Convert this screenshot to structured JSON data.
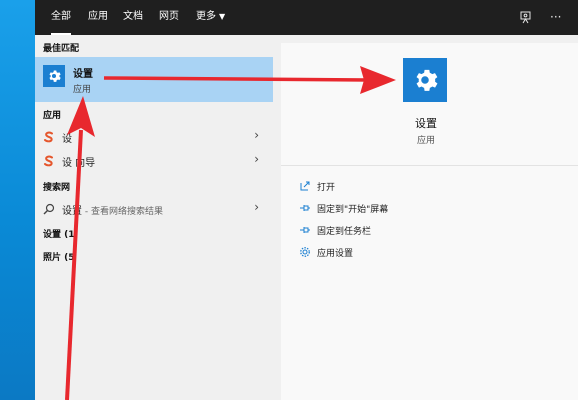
{
  "tabs": [
    "全部",
    "应用",
    "文档",
    "网页",
    "更多"
  ],
  "best_match": {
    "header": "最佳匹配",
    "title": "设置",
    "subtitle": "应用"
  },
  "apps": {
    "header": "应用",
    "items": [
      {
        "label": "设"
      },
      {
        "label": "设 向导"
      }
    ]
  },
  "web": {
    "header": "搜索网",
    "query": "设置",
    "suffix": " - 查看网络搜索结果"
  },
  "settings_header": "设置 (1",
  "photos_header": "照片 (5",
  "detail": {
    "title": "设置",
    "subtitle": "应用",
    "actions": [
      {
        "label": "打开",
        "icon": "open-icon"
      },
      {
        "label": "固定到\"开始\"屏幕",
        "icon": "pin-icon"
      },
      {
        "label": "固定到任务栏",
        "icon": "pin-icon"
      },
      {
        "label": "应用设置",
        "icon": "gear-icon"
      }
    ]
  },
  "colors": {
    "topbar": "#1f1f1f",
    "accent": "#1b7fd1",
    "highlight": "#a9d3f4",
    "arrow": "#e8282e"
  }
}
